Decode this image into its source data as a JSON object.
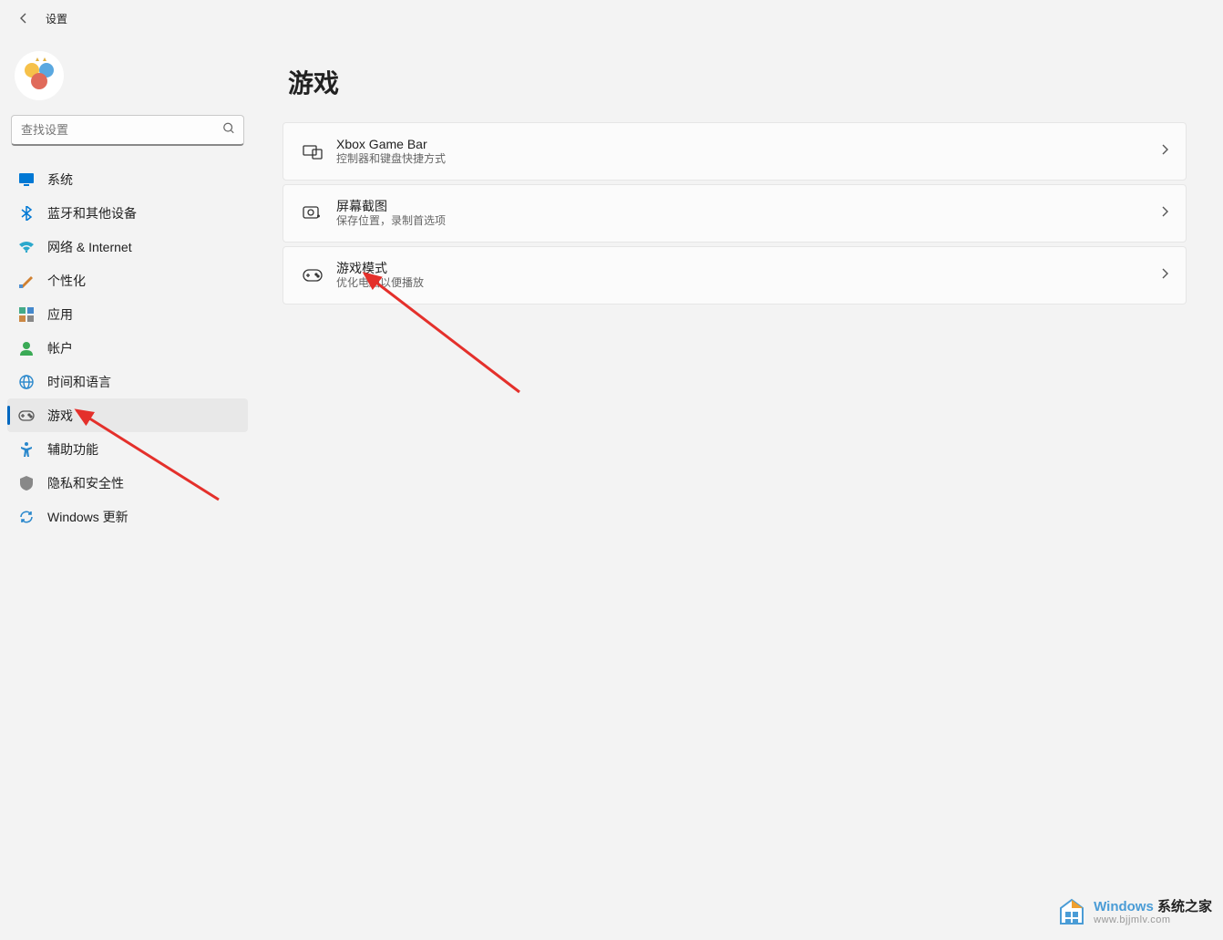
{
  "app": {
    "title": "设置"
  },
  "search": {
    "placeholder": "查找设置"
  },
  "sidebar": {
    "items": [
      {
        "label": "系统"
      },
      {
        "label": "蓝牙和其他设备"
      },
      {
        "label": "网络 & Internet"
      },
      {
        "label": "个性化"
      },
      {
        "label": "应用"
      },
      {
        "label": "帐户"
      },
      {
        "label": "时间和语言"
      },
      {
        "label": "游戏"
      },
      {
        "label": "辅助功能"
      },
      {
        "label": "隐私和安全性"
      },
      {
        "label": "Windows 更新"
      }
    ]
  },
  "page": {
    "title": "游戏"
  },
  "cards": [
    {
      "title": "Xbox Game Bar",
      "sub": "控制器和键盘快捷方式"
    },
    {
      "title": "屏幕截图",
      "sub": "保存位置，录制首选项"
    },
    {
      "title": "游戏模式",
      "sub": "优化电脑以便播放"
    }
  ],
  "watermark": {
    "brand_prefix": "Windows",
    "brand_suffix": " 系统之家",
    "url": "www.bjjmlv.com"
  }
}
